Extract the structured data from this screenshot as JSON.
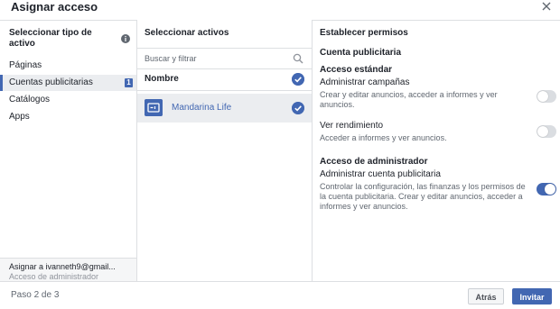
{
  "dialog": {
    "title": "Asignar acceso",
    "close_icon": "close-icon"
  },
  "left": {
    "heading": "Seleccionar tipo de activo",
    "info_icon": "info-icon",
    "items": [
      {
        "label": "Páginas",
        "active": false
      },
      {
        "label": "Cuentas publicitarias",
        "active": true,
        "badge": "1"
      },
      {
        "label": "Catálogos",
        "active": false
      },
      {
        "label": "Apps",
        "active": false
      }
    ],
    "assign": {
      "name": "Asignar a ivanneth9@gmail...",
      "role": "Acceso de administrador"
    }
  },
  "middle": {
    "heading": "Seleccionar activos",
    "search_placeholder": "Buscar y filtrar",
    "name_header": "Nombre",
    "assets": [
      {
        "name": "Mandarina Life",
        "selected": true
      }
    ]
  },
  "right": {
    "heading": "Establecer permisos",
    "account_label": "Cuenta publicitaria",
    "standard_label": "Acceso estándar",
    "admin_label": "Acceso de administrador",
    "permissions": [
      {
        "title": "Administrar campañas",
        "desc": "Crear y editar anuncios, acceder a informes y ver anuncios.",
        "enabled": false
      },
      {
        "title": "Ver rendimiento",
        "desc": "Acceder a informes y ver anuncios.",
        "enabled": false
      },
      {
        "title": "Administrar cuenta publicitaria",
        "desc": "Controlar la configuración, las finanzas y los permisos de la cuenta publicitaria. Crear y editar anuncios, acceder a informes y ver anuncios.",
        "enabled": true
      }
    ]
  },
  "footer": {
    "step": "Paso 2 de 3",
    "back_label": "Atrás",
    "invite_label": "Invitar"
  },
  "colors": {
    "accent": "#4267b2",
    "border": "#dddfe2",
    "muted": "#606770"
  }
}
